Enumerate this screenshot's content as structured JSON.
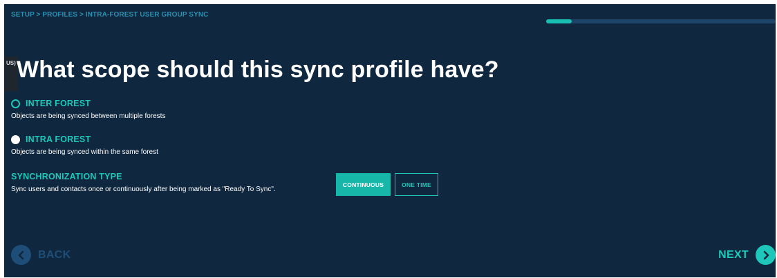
{
  "breadcrumb": "SETUP > PROFILES > INTRA-FOREST USER GROUP SYNC",
  "progress": {
    "fraction": 0.11,
    "fill_color": "#19c0b2",
    "track_color": "#1e4468"
  },
  "side_tab": {
    "label": "US)"
  },
  "page_title": "What scope should this sync profile have?",
  "scope_options": [
    {
      "label": "INTER FOREST",
      "description": "Objects are being synced between multiple forests",
      "selected": false
    },
    {
      "label": "INTRA FOREST",
      "description": "Objects are being synced within the same forest",
      "selected": true
    }
  ],
  "sync_type": {
    "title": "SYNCHRONIZATION TYPE",
    "description": "Sync users and contacts once or continuously after being marked as \"Ready To Sync\".",
    "options": [
      {
        "label": "CONTINUOUS",
        "active": true
      },
      {
        "label": "ONE TIME",
        "active": false
      }
    ]
  },
  "navigation": {
    "back_label": "BACK",
    "next_label": "NEXT",
    "back_icon": "chevron-left-icon",
    "next_icon": "chevron-right-icon"
  },
  "colors": {
    "background": "#10283f",
    "accent": "#1ec7b9",
    "breadcrumb": "#2a8fb0",
    "muted_nav": "#1e4e78"
  }
}
